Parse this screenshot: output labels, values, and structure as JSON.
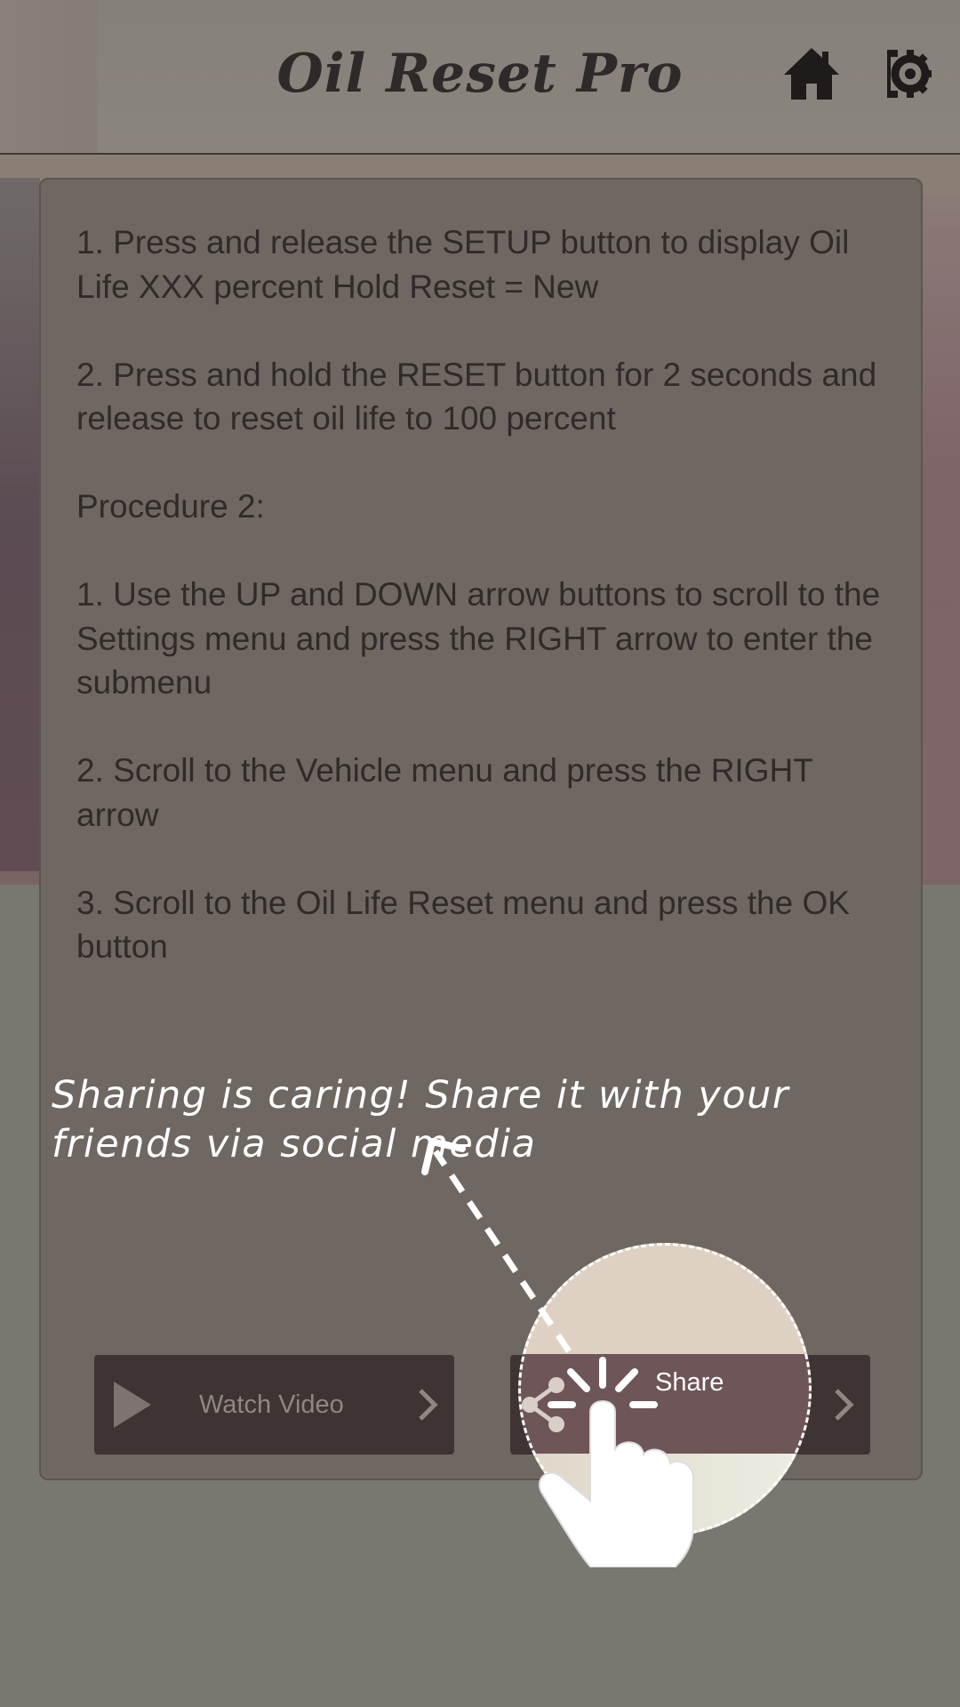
{
  "header": {
    "title": "Oil Reset Pro",
    "home_icon": "home-icon",
    "settings_icon": "settings-gear-icon"
  },
  "content": {
    "paragraphs": [
      "1. Press and release the SETUP button to display Oil Life XXX percent Hold Reset = New",
      "2. Press and hold the RESET button for 2 seconds and release to reset oil life to 100 percent",
      "Procedure 2:",
      "1. Use the UP and DOWN arrow buttons to scroll to the Settings menu and press the RIGHT arrow to enter the submenu",
      "2. Scroll to the Vehicle menu and press the RIGHT arrow",
      "3. Scroll to the Oil Life Reset menu and press the OK button"
    ]
  },
  "buttons": {
    "watch_video_label": "Watch Video",
    "share_label": "Share"
  },
  "tutorial": {
    "hint": "Sharing is caring! Share it with your friends via social media"
  },
  "colors": {
    "card_background": "#6f6761",
    "button_background": "#3d3433",
    "text_dark": "#2f2b2a",
    "hint_text": "#ffffff"
  }
}
